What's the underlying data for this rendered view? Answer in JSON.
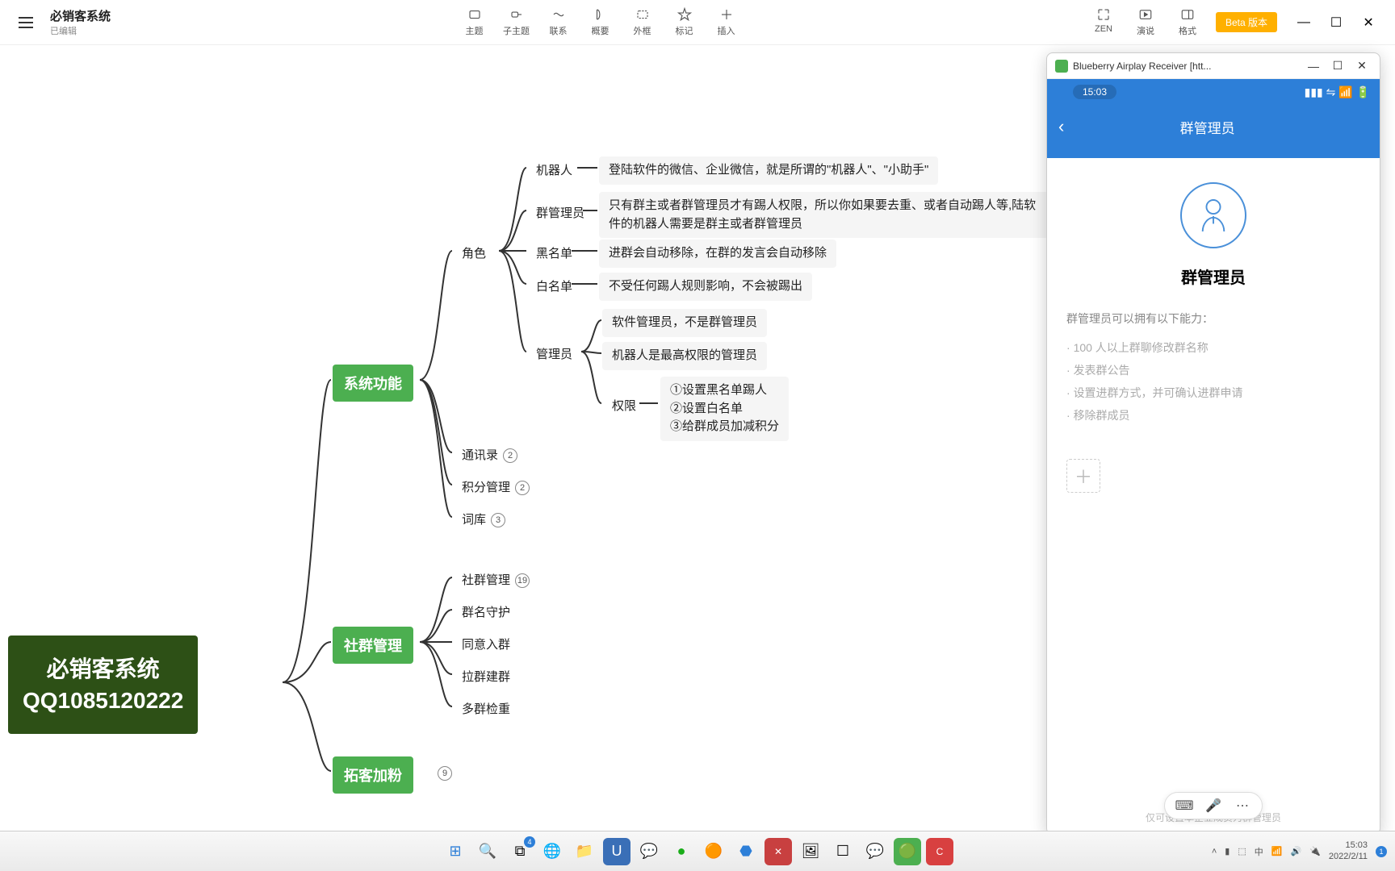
{
  "app": {
    "title": "必销客系统",
    "subtitle": "已编辑"
  },
  "toolbar": {
    "items": [
      {
        "label": "主题"
      },
      {
        "label": "子主题"
      },
      {
        "label": "联系"
      },
      {
        "label": "概要"
      },
      {
        "label": "外框"
      },
      {
        "label": "标记"
      },
      {
        "label": "插入"
      }
    ],
    "right": [
      {
        "label": "ZEN"
      },
      {
        "label": "演说"
      },
      {
        "label": "格式"
      }
    ],
    "beta": "Beta 版本"
  },
  "root": {
    "line1": "必销客系统",
    "line2": "QQ1085120222"
  },
  "branches": {
    "b1": "系统功能",
    "b2": "社群管理",
    "b3": "拓客加粉",
    "b3_badge": "9"
  },
  "l1": {
    "role": "角色",
    "robot": "机器人",
    "robot_desc": "登陆软件的微信、企业微信，就是所谓的\"机器人\"、\"小助手\"",
    "gm": "群管理员",
    "gm_desc": "只有群主或者群管理员才有踢人权限，所以你如果要去重、或者自动踢人等,陆软件的机器人需要是群主或者群管理员",
    "bl": "黑名单",
    "bl_desc": "进群会自动移除，在群的发言会自动移除",
    "wl": "白名单",
    "wl_desc": "不受任何踢人规则影响，不会被踢出",
    "admin": "管理员",
    "admin_d1": "软件管理员，不是群管理员",
    "admin_d2": "机器人是最高权限的管理员",
    "perm": "权限",
    "perm_d": "①设置黑名单踢人\n②设置白名单\n③给群成员加减积分",
    "contacts": "通讯录",
    "contacts_b": "2",
    "points": "积分管理",
    "points_b": "2",
    "dict": "词库",
    "dict_b": "3"
  },
  "l2": {
    "sg": "社群管理",
    "sg_b": "19",
    "gn": "群名守护",
    "agree": "同意入群",
    "pull": "拉群建群",
    "dup": "多群检重"
  },
  "overlay": {
    "title": "Blueberry Airplay Receiver [htt...",
    "time": "15:03",
    "nav_title": "群管理员",
    "gm_title": "群管理员",
    "gm_desc": "群管理员可以拥有以下能力：",
    "perms": [
      "100 人以上群聊修改群名称",
      "发表群公告",
      "设置进群方式，并可确认进群申请",
      "移除群成员"
    ],
    "foot": "仅可设置本企业成员为群管理员"
  },
  "taskbar": {
    "time": "15:03",
    "date": "2022/2/11",
    "badge": "1",
    "fbadge": "4"
  }
}
